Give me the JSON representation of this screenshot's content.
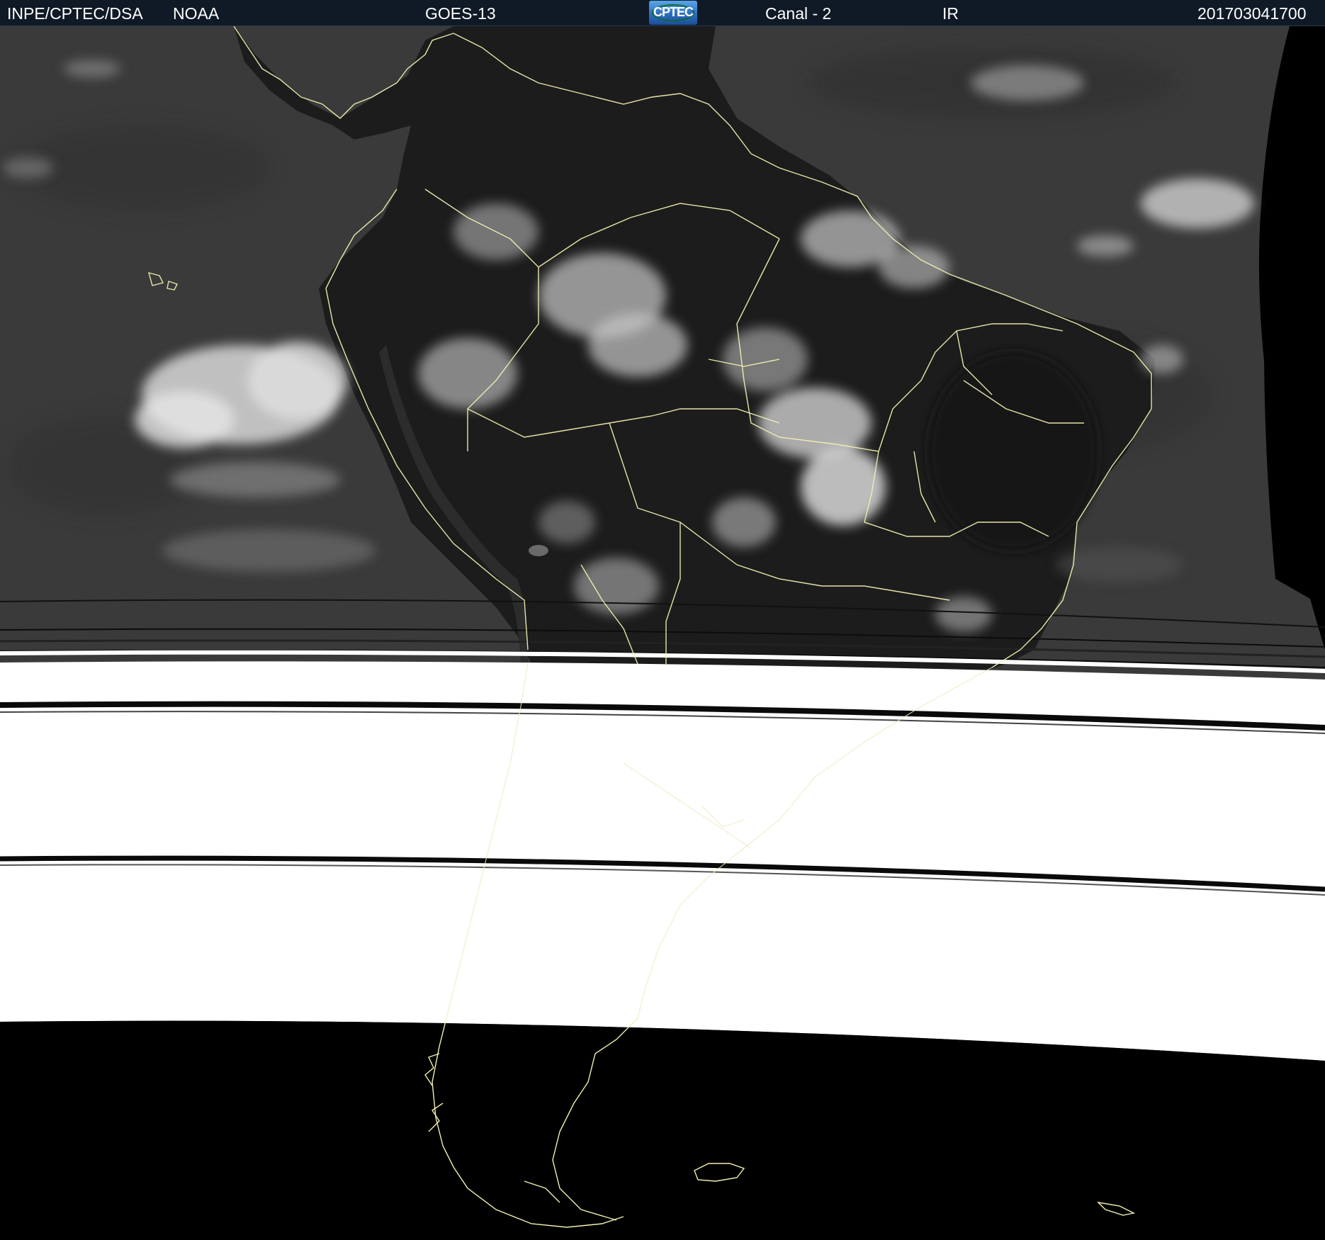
{
  "header": {
    "agency": "INPE/CPTEC/DSA",
    "source": "NOAA",
    "satellite": "GOES-13",
    "logo_text": "CPTEC",
    "channel": "Canal - 2",
    "band": "IR",
    "timestamp": "201703041700"
  },
  "image": {
    "description_icon": "satellite-ir-image",
    "colors": {
      "ocean": "#3a3a3a",
      "land": "#1c1c1c",
      "cloud": "#d8d8d8",
      "missing_data": "#ffffff",
      "space": "#000000",
      "borders": "#f3f0b0"
    }
  }
}
